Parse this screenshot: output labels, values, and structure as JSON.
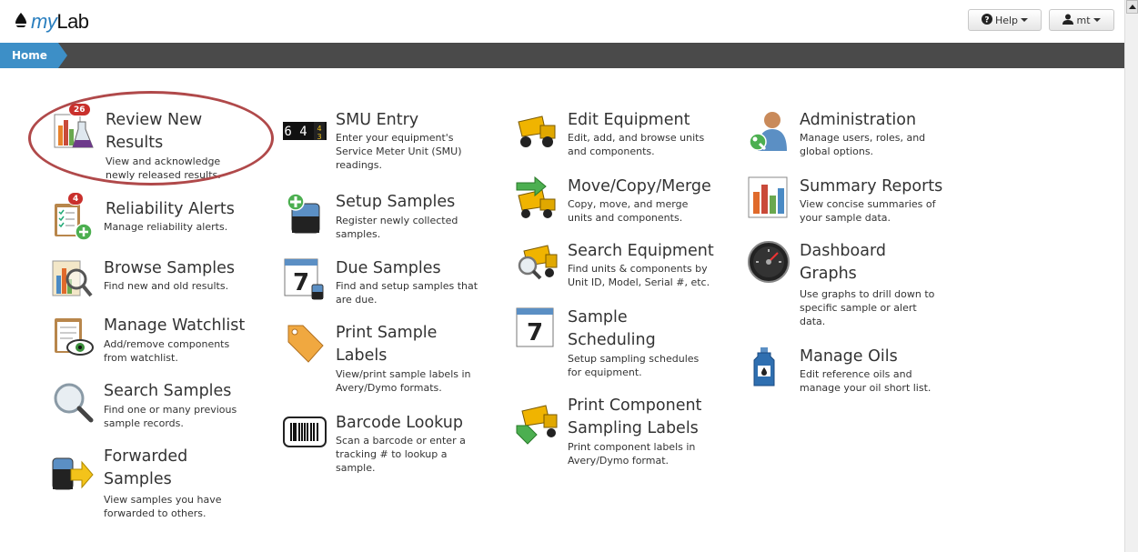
{
  "header": {
    "logo_text": "myLab",
    "help_label": "Help",
    "user_label": "mt"
  },
  "breadcrumb": {
    "home_label": "Home"
  },
  "tiles": {
    "review_new_results": {
      "title_line1": "Review New",
      "title_line2": "Results",
      "desc_line1": "View and acknowledge",
      "desc_line2": "newly released results.",
      "badge": "26"
    },
    "reliability_alerts": {
      "title": "Reliability Alerts",
      "desc_line1": "Manage reliability alerts.",
      "badge": "4"
    },
    "browse_samples": {
      "title": "Browse Samples",
      "desc_line1": "Find new and old results."
    },
    "manage_watchlist": {
      "title": "Manage Watchlist",
      "desc_line1": "Add/remove components",
      "desc_line2": "from watchlist."
    },
    "search_samples": {
      "title": "Search Samples",
      "desc_line1": "Find one or many previous",
      "desc_line2": "sample records."
    },
    "forwarded_samples": {
      "title_line1": "Forwarded",
      "title_line2": "Samples",
      "desc_line1": "View samples you have",
      "desc_line2": "forwarded to others."
    },
    "smu_entry": {
      "title": "SMU Entry",
      "desc_line1": "Enter your equipment's",
      "desc_line2": "Service Meter Unit (SMU)",
      "desc_line3": "readings.",
      "icon_digits": "6 4"
    },
    "setup_samples": {
      "title": "Setup Samples",
      "desc_line1": "Register newly collected",
      "desc_line2": "samples."
    },
    "due_samples": {
      "title": "Due Samples",
      "desc_line1": "Find and setup samples that",
      "desc_line2": "are due.",
      "icon_number": "7"
    },
    "print_sample_labels": {
      "title_line1": "Print Sample",
      "title_line2": "Labels",
      "desc_line1": "View/print sample labels in",
      "desc_line2": "Avery/Dymo formats."
    },
    "barcode_lookup": {
      "title": "Barcode Lookup",
      "desc_line1": "Scan a barcode or enter a",
      "desc_line2": "tracking # to lookup a",
      "desc_line3": "sample."
    },
    "edit_equipment": {
      "title": "Edit Equipment",
      "desc_line1": "Edit, add, and browse units",
      "desc_line2": "and components."
    },
    "move_copy_merge": {
      "title": "Move/Copy/Merge",
      "desc_line1": "Copy, move, and merge",
      "desc_line2": "units and components."
    },
    "search_equipment": {
      "title": "Search Equipment",
      "desc_line1": "Find units & components by",
      "desc_line2": "Unit ID, Model, Serial #, etc."
    },
    "sample_scheduling": {
      "title_line1": "Sample",
      "title_line2": "Scheduling",
      "desc_line1": "Setup sampling schedules",
      "desc_line2": "for equipment.",
      "icon_number": "7"
    },
    "print_component_labels": {
      "title_line1": "Print Component",
      "title_line2": "Sampling Labels",
      "desc_line1": "Print component labels in",
      "desc_line2": "Avery/Dymo format."
    },
    "administration": {
      "title": "Administration",
      "desc_line1": "Manage users, roles, and",
      "desc_line2": "global options."
    },
    "summary_reports": {
      "title": "Summary Reports",
      "desc_line1": "View concise summaries of",
      "desc_line2": "your sample data."
    },
    "dashboard_graphs": {
      "title_line1": "Dashboard",
      "title_line2": "Graphs",
      "desc_line1": "Use graphs to drill down to",
      "desc_line2": "specific sample or alert",
      "desc_line3": "data."
    },
    "manage_oils": {
      "title": "Manage Oils",
      "desc_line1": "Edit reference oils and",
      "desc_line2": "manage your oil short list."
    }
  }
}
